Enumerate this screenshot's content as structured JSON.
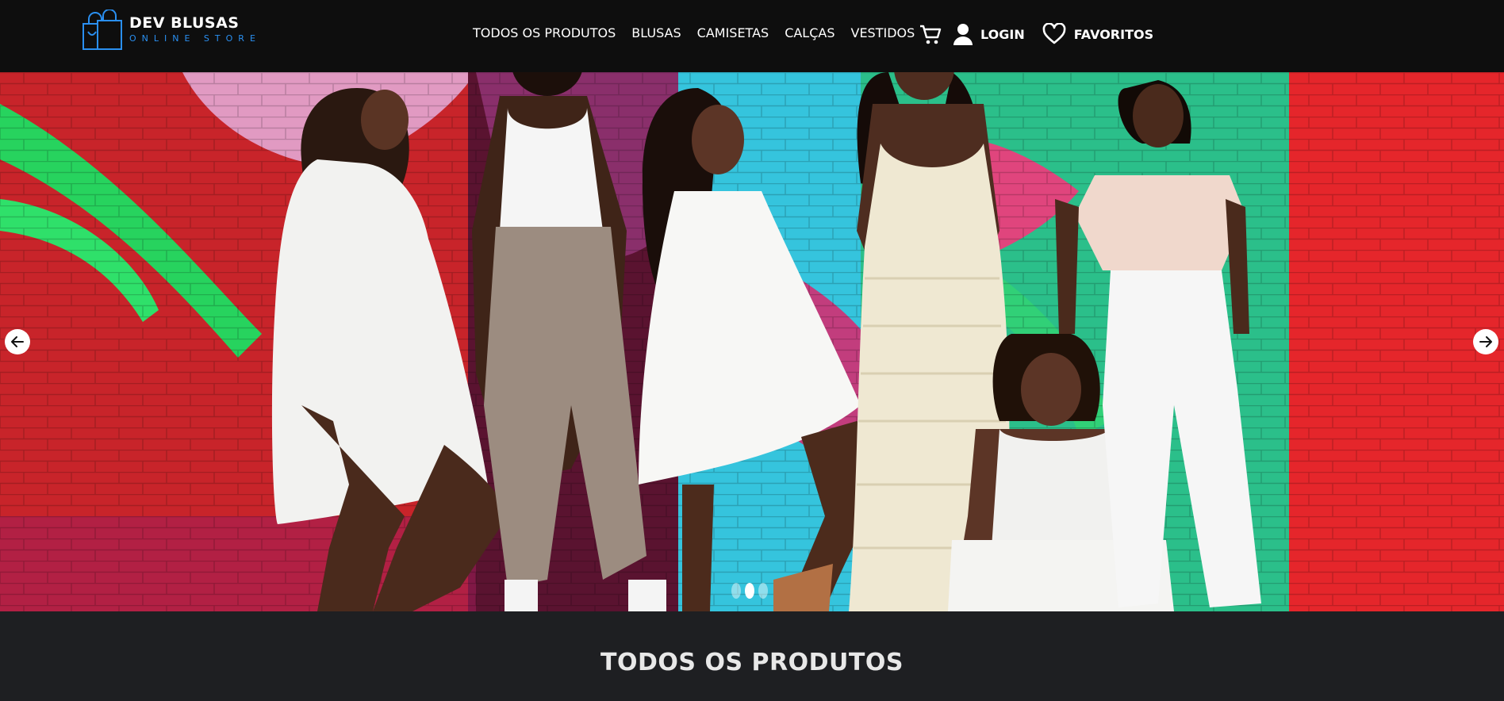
{
  "brand": {
    "name": "DEV BLUSAS",
    "tagline": "ONLINE STORE",
    "icon": "shopping-bags-icon",
    "accent_color": "#2a8ff0"
  },
  "nav": {
    "items": [
      {
        "label": "TODOS OS PRODUTOS"
      },
      {
        "label": "BLUSAS"
      },
      {
        "label": "CAMISETAS"
      },
      {
        "label": "CALÇAS"
      },
      {
        "label": "VESTIDOS"
      }
    ]
  },
  "actions": {
    "cart_icon": "cart-icon",
    "login_icon": "user-icon",
    "login_label": "LOGIN",
    "favorites_icon": "heart-icon",
    "favorites_label": "FAVORITOS"
  },
  "carousel": {
    "prev_icon": "arrow-left-icon",
    "next_icon": "arrow-right-icon",
    "slide_count": 3,
    "active_slide": 2
  },
  "section": {
    "title": "TODOS OS PRODUTOS"
  },
  "colors": {
    "header_bg": "#0e0e0e",
    "page_bg": "#1e1f22"
  }
}
